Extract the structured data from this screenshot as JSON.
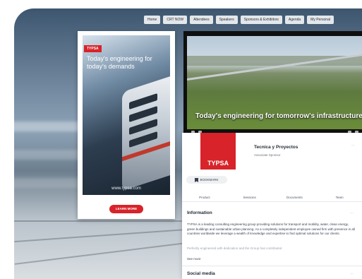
{
  "nav": {
    "items": [
      "Home",
      "CRT NOW",
      "Attendees",
      "Speakers",
      "Sponsors & Exhibitors",
      "Agenda",
      "My Personal"
    ]
  },
  "ad": {
    "brand": "TYPSA",
    "tagline": "Today's engineering for today's demands",
    "url": "www.typsa.com",
    "cta": "LEARN MORE",
    "brand_color": "#d8232a"
  },
  "video": {
    "caption": "Today's engineering for tomorrow's infrastructure"
  },
  "exhibitor": {
    "logo_text": "TYPSA",
    "name": "Tecnica y Proyectos",
    "subtitle": "Associate Sponsor",
    "more": "…",
    "bookmark_icon": "bookmark-icon",
    "bookmark_label": "BOOKMARK",
    "tabs": [
      "Product",
      "Sessions",
      "Documents",
      "Team"
    ]
  },
  "information": {
    "title": "Information",
    "more": "…",
    "text": "TYPSA is a leading consulting engineering group providing solutions for transport and mobility, water, clean energy, green buildings and sustainable urban planning. As a completely independent employee owned firm with presence in all countries worldwide we leverage a wealth of knowledge and expertise to find optimal solutions for our clients.",
    "text_faded": "Perfectly engineered with dedication and the Group has contributed",
    "see_more": "See more"
  },
  "social": {
    "title": "Social media",
    "more": "…"
  }
}
